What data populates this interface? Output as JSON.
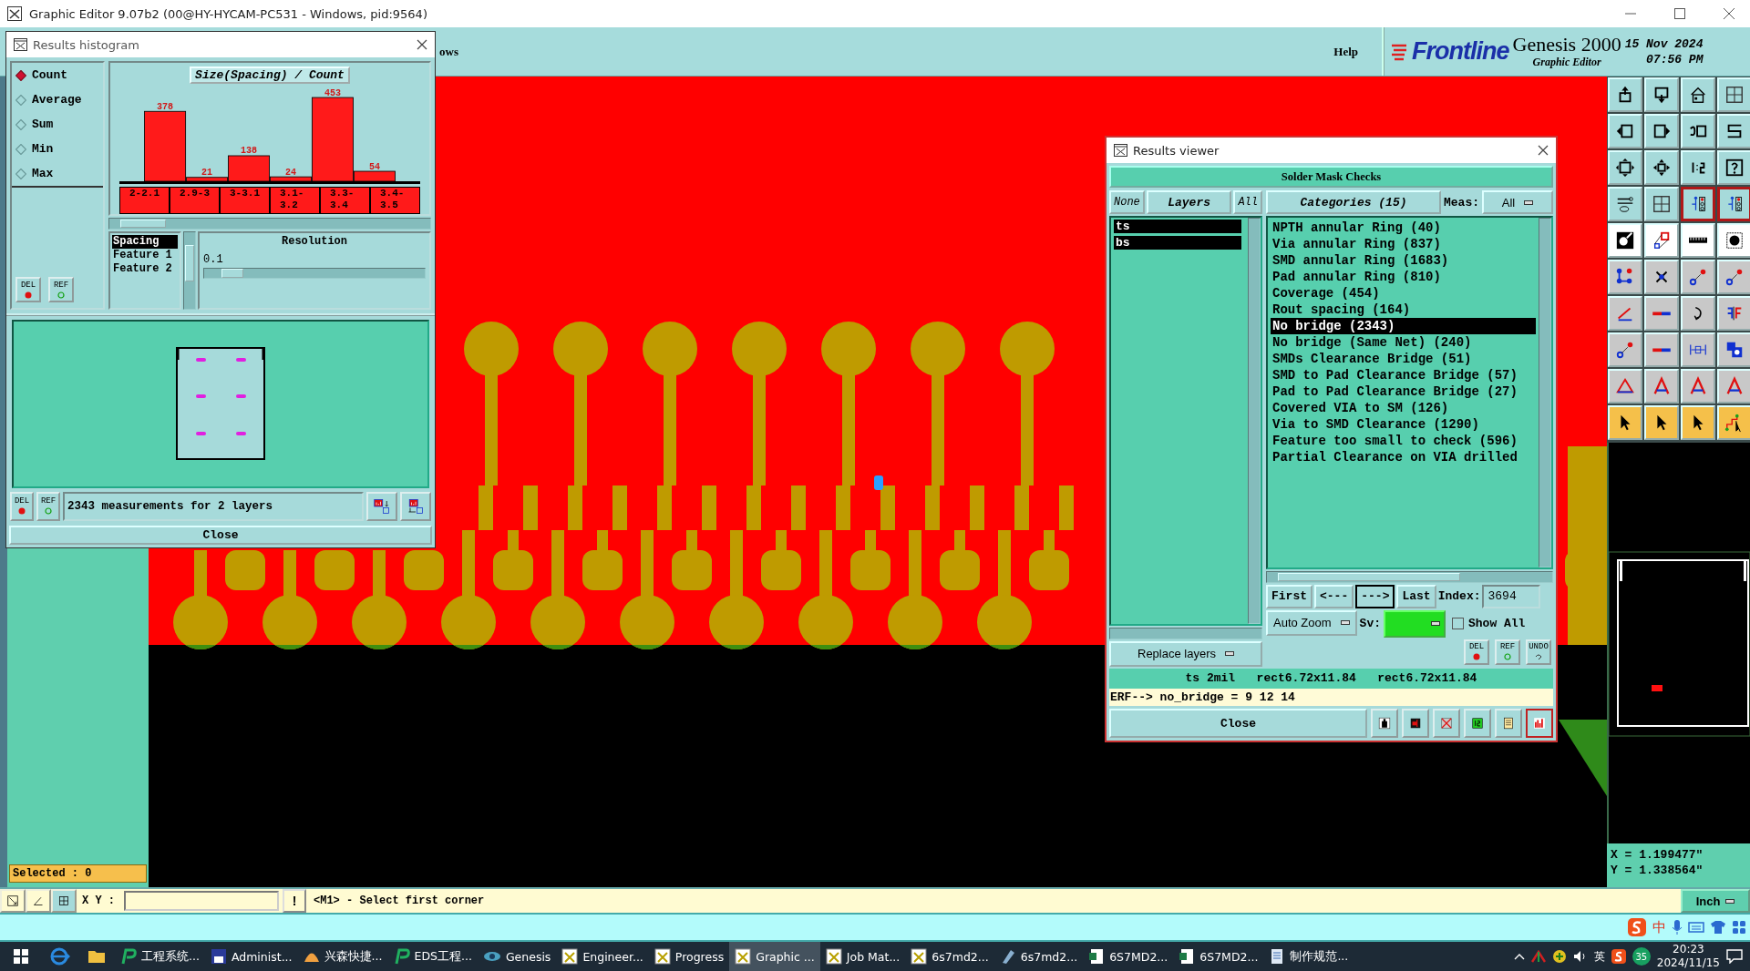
{
  "window": {
    "title": "Graphic Editor 9.07b2 (00@HY-HYCAM-PC531 - Windows, pid:9564)"
  },
  "menu": [
    {
      "label": "ows"
    },
    {
      "label": "Help"
    }
  ],
  "brand": {
    "logo": "Frontline",
    "product": "Genesis 2000",
    "subtitle": "Graphic Editor",
    "date": "15 Nov 2024",
    "time": "07:56 PM"
  },
  "histogram": {
    "title": "Results histogram",
    "modes": [
      {
        "label": "Count",
        "selected": true
      },
      {
        "label": "Average",
        "selected": false
      },
      {
        "label": "Sum",
        "selected": false
      },
      {
        "label": "Min",
        "selected": false
      },
      {
        "label": "Max",
        "selected": false
      }
    ],
    "side_buttons": [
      "DEL",
      "REF"
    ],
    "chart_data": {
      "type": "bar",
      "title": "Size(Spacing) / Count",
      "categories": [
        "2-2.1",
        "2.9-3",
        "3-3.1",
        "3.1-3.2",
        "3.3-3.4",
        "3.4-3.5"
      ],
      "values": [
        378,
        21,
        138,
        24,
        453,
        54
      ],
      "data_labels": true
    },
    "fields": [
      {
        "label": "Spacing",
        "selected": true
      },
      {
        "label": "Feature 1",
        "selected": false
      },
      {
        "label": "Feature 2",
        "selected": false
      }
    ],
    "resolution": {
      "label": "Resolution",
      "value": "0.1",
      "level": 0.08
    },
    "status_buttons": [
      "DEL",
      "REF"
    ],
    "status": "2343 measurements for 2 layers",
    "close": "Close"
  },
  "viewer": {
    "title": "Results viewer",
    "header": "Solder Mask Checks",
    "tabs": [
      {
        "label": "None",
        "selected": false
      },
      {
        "label": "Layers",
        "selected": true
      },
      {
        "label": "All",
        "selected": false
      }
    ],
    "layers": [
      {
        "label": "ts",
        "selected": true
      },
      {
        "label": "bs",
        "selected": true
      }
    ],
    "categories_header": "Categories (15)",
    "meas_label": "Meas:",
    "meas_value": "All",
    "categories": [
      {
        "label": "NPTH annular Ring (40)",
        "selected": false
      },
      {
        "label": "Via annular Ring (837)",
        "selected": false
      },
      {
        "label": "SMD annular Ring (1683)",
        "selected": false
      },
      {
        "label": "Pad annular Ring (810)",
        "selected": false
      },
      {
        "label": "Coverage (454)",
        "selected": false
      },
      {
        "label": "Rout spacing (164)",
        "selected": false
      },
      {
        "label": "No bridge (2343)",
        "selected": true
      },
      {
        "label": "No bridge (Same Net) (240)",
        "selected": false
      },
      {
        "label": "SMDs Clearance Bridge (51)",
        "selected": false
      },
      {
        "label": "SMD to Pad Clearance Bridge (57)",
        "selected": false
      },
      {
        "label": "Pad to Pad Clearance Bridge (27)",
        "selected": false
      },
      {
        "label": "Covered VIA to SM (126)",
        "selected": false
      },
      {
        "label": "Via to SMD Clearance (1290)",
        "selected": false
      },
      {
        "label": "Feature too small to check (596)",
        "selected": false
      },
      {
        "label": "Partial Clearance on VIA drilled",
        "selected": false
      }
    ],
    "nav": [
      {
        "label": "First",
        "selected": false
      },
      {
        "label": "<---",
        "selected": false
      },
      {
        "label": "--->",
        "selected": true
      },
      {
        "label": "Last",
        "selected": false
      }
    ],
    "index_label": "Index:",
    "index_value": "3694",
    "zoom": "Auto Zoom",
    "sv_label": "Sv:",
    "show_all": {
      "label": "Show All",
      "checked": false
    },
    "replace": "Replace layers",
    "action_buttons": [
      "DEL",
      "REF",
      "UNDO"
    ],
    "info": "ts 2mil   rect6.72x11.84   rect6.72x11.84",
    "erf": "ERF--> no_bridge = 9 12 14",
    "close": "Close"
  },
  "left_panel": {
    "selected": "Selected : 0"
  },
  "coords": {
    "x": "X = 1.199477\"",
    "y": "Y = 1.338564\""
  },
  "command": {
    "label": "X Y :",
    "button": "!",
    "prompt": "<M1> - Select first corner",
    "units": "Inch"
  },
  "ime": {
    "mode": "中"
  },
  "taskbar": {
    "items": [
      {
        "label": "工程系统...",
        "kind": "app",
        "selected": false
      },
      {
        "label": "Administ...",
        "kind": "disk",
        "selected": false
      },
      {
        "label": "兴森快捷...",
        "kind": "shell",
        "selected": false
      },
      {
        "label": "EDS工程...",
        "kind": "app",
        "selected": false
      },
      {
        "label": "Genesis",
        "kind": "eye",
        "selected": false
      },
      {
        "label": "Engineer...",
        "kind": "window",
        "selected": false
      },
      {
        "label": "Progress",
        "kind": "window",
        "selected": false
      },
      {
        "label": "Graphic ...",
        "kind": "window",
        "selected": true
      },
      {
        "label": "Job Mat...",
        "kind": "window",
        "selected": false
      },
      {
        "label": "6s7md2...",
        "kind": "window",
        "selected": false
      },
      {
        "label": "6s7md2...",
        "kind": "pen",
        "selected": false
      },
      {
        "label": "6S7MD2...",
        "kind": "sheet",
        "selected": false
      },
      {
        "label": "6S7MD2...",
        "kind": "sheet",
        "selected": false
      },
      {
        "label": "制作规范...",
        "kind": "doc",
        "selected": false
      }
    ],
    "tray": {
      "language": "英",
      "badge": "35",
      "time": "20:23",
      "date": "2024/11/15"
    }
  }
}
